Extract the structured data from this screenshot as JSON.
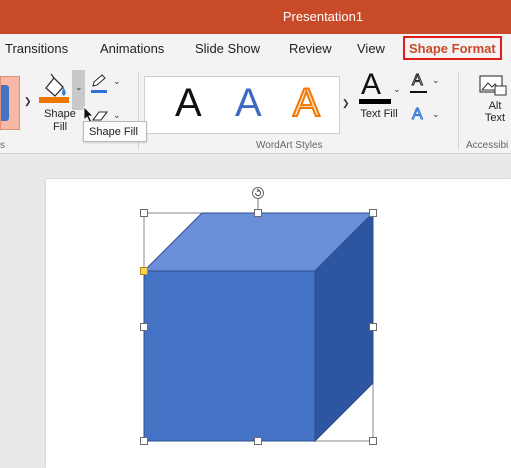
{
  "window": {
    "title": "Presentation1"
  },
  "tabs": [
    {
      "label": "Transitions"
    },
    {
      "label": "Animations"
    },
    {
      "label": "Slide Show"
    },
    {
      "label": "Review"
    },
    {
      "label": "View"
    },
    {
      "label": "Shape Format"
    }
  ],
  "ribbon": {
    "shape_fill": {
      "label_line1": "Shape",
      "label_line2": "Fill",
      "color": "#f07800"
    },
    "outline_color": "#2f72d6",
    "styles_group_label": "s",
    "wordart": {
      "glyph": "A",
      "group_label": "WordArt Styles",
      "styles": [
        {
          "name": "black-fill",
          "color": "#111111"
        },
        {
          "name": "blue-gradient",
          "color": "#3d6bc4"
        },
        {
          "name": "orange-outline",
          "color": "#f07800"
        }
      ]
    },
    "text_fill": {
      "label": "Text Fill",
      "bar_color": "#000000"
    },
    "text_outline_glyph": "A",
    "text_effects_glyph": "A",
    "alt_text": {
      "line1": "Alt",
      "line2": "Text"
    },
    "accessibility_group_label": "Accessibi"
  },
  "tooltip": {
    "text": "Shape Fill"
  },
  "cube": {
    "front_color": "#4472c4",
    "top_color": "#6a8fd8",
    "side_color": "#2e55a2",
    "edge_color": "#2f4f8f"
  }
}
